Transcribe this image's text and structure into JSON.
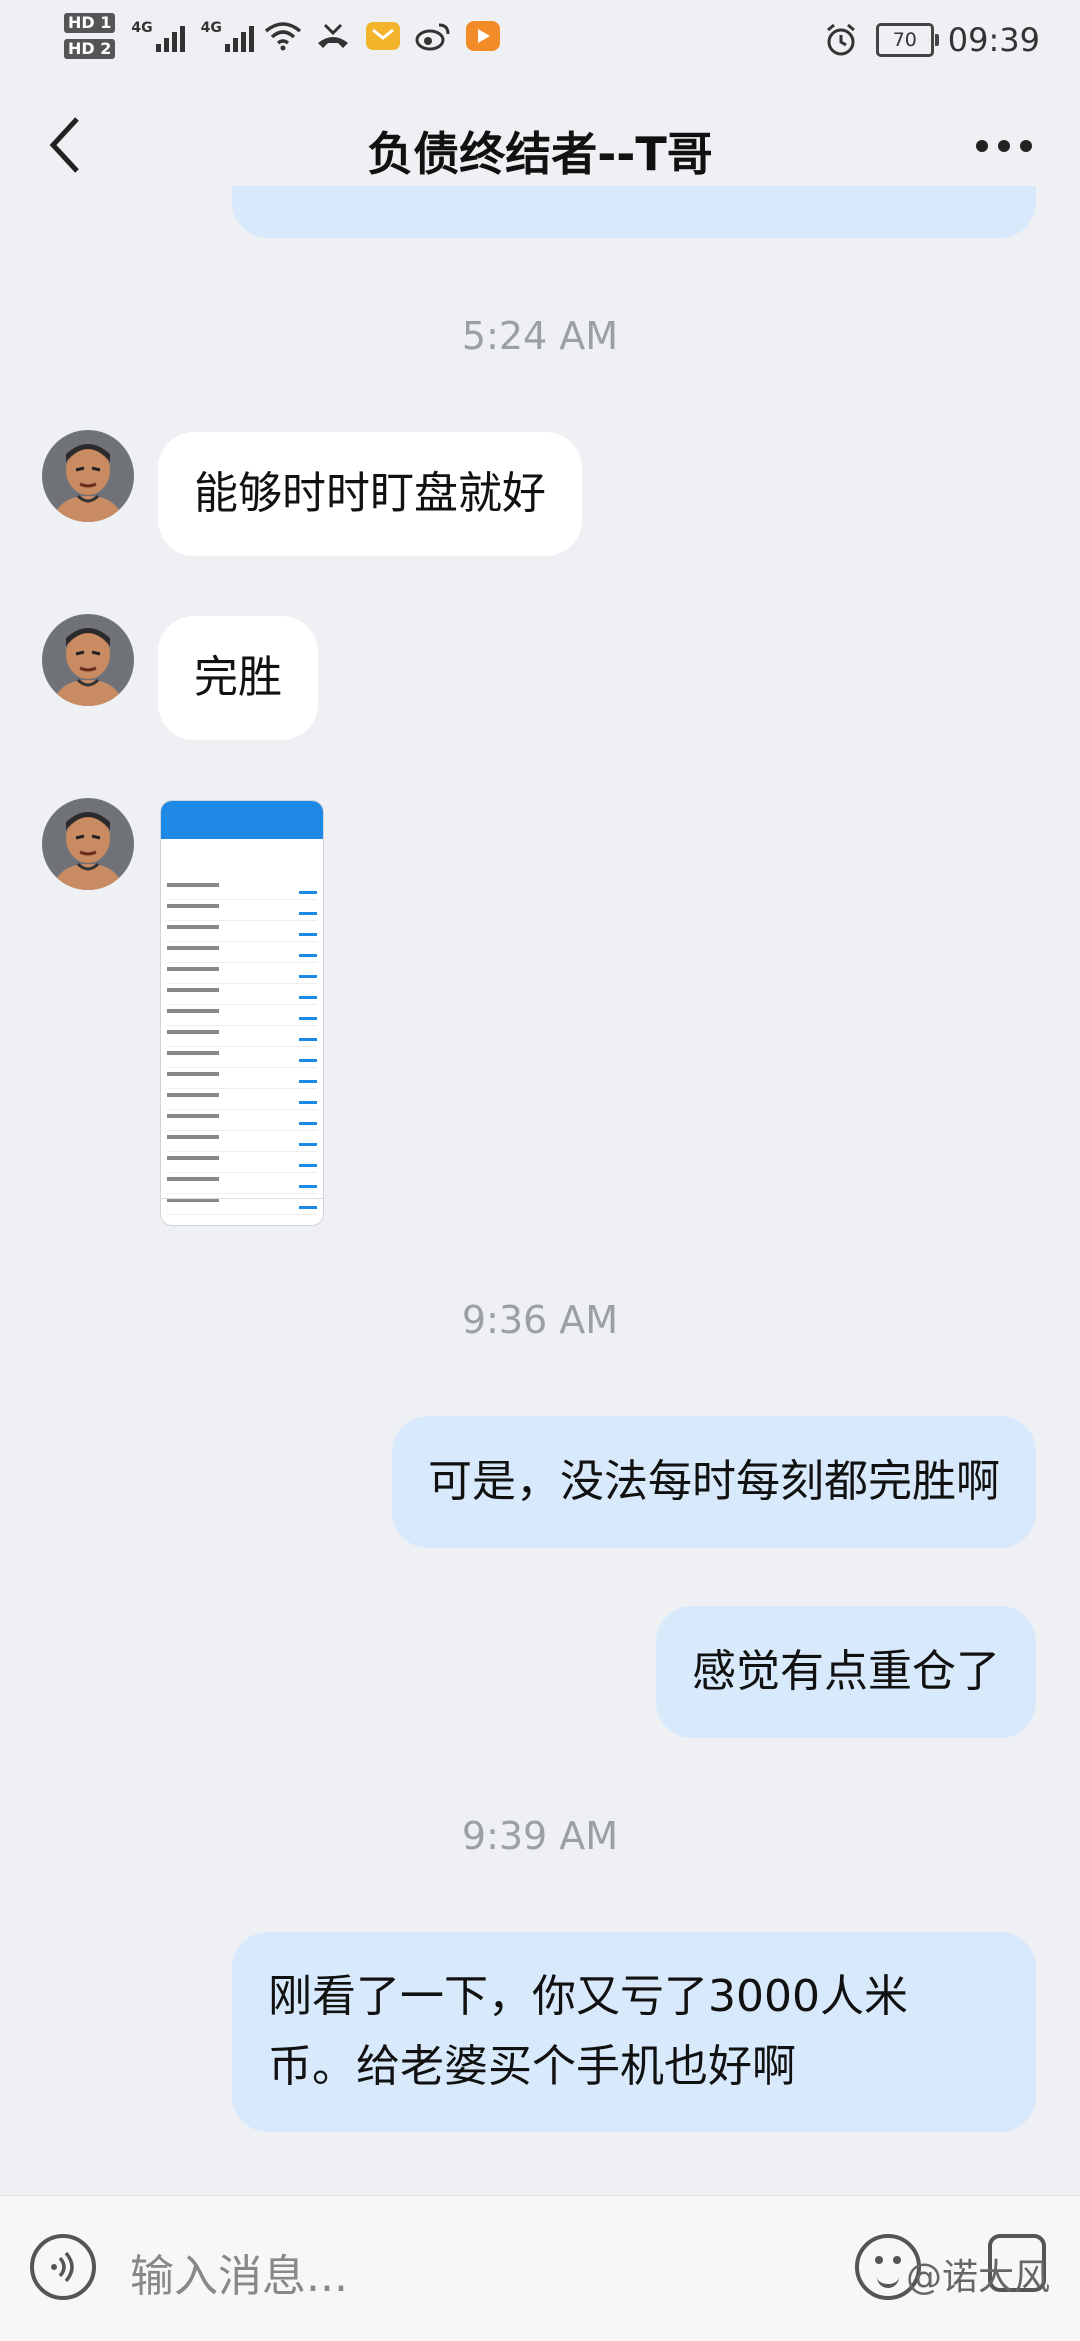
{
  "status_bar": {
    "hd1": "HD 1",
    "hd2": "HD 2",
    "net1": "4G",
    "net2": "4G",
    "battery": "70",
    "clock": "09:39",
    "icons": [
      "wifi-icon",
      "missed-call-icon",
      "mail-notification-icon",
      "weibo-icon",
      "video-app-icon",
      "alarm-icon",
      "battery-icon"
    ]
  },
  "header": {
    "title": "负债终结者--T哥"
  },
  "messages": {
    "time1": "5:24 AM",
    "m1": "能够时时盯盘就好",
    "m2": "完胜",
    "time2": "9:36 AM",
    "m4": "可是，没法每时每刻都完胜啊",
    "m5": "感觉有点重仓了",
    "time3": "9:39 AM",
    "m6_line1": "刚看了一下，你又亏了3000人米",
    "m6_line2": "币。给老婆买个手机也好啊"
  },
  "input": {
    "placeholder": "输入消息...",
    "watermark": "@诺大风"
  },
  "colors": {
    "background": "#eef0f3",
    "incoming_bubble": "#ffffff",
    "outgoing_bubble": "#d7e9fb",
    "timestamp": "#9aa0a6"
  }
}
